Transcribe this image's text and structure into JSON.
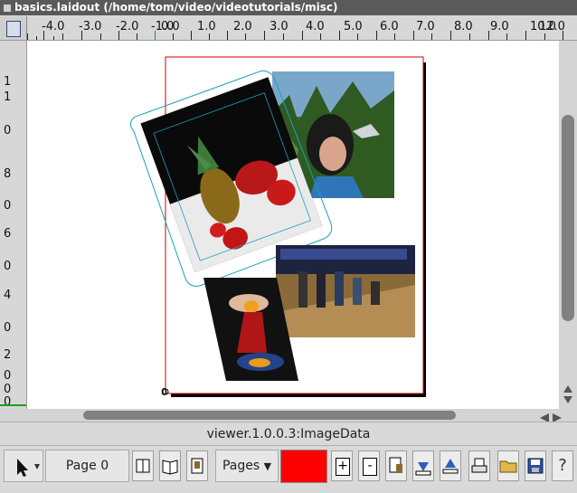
{
  "window": {
    "title": "basics.laidout (/home/tom/video/videotutorials/misc)"
  },
  "ruler": {
    "labels": [
      "-4.0",
      "-3.0",
      "-2.0",
      "-1.0",
      "0.0",
      "1.0",
      "2.0",
      "3.0",
      "4.0",
      "5.0",
      "6.0",
      "7.0",
      "8.0",
      "9.0",
      "10.0",
      "12.0"
    ],
    "vertical_labels": [
      "1",
      "1",
      "0",
      "8",
      "0",
      "6",
      "0",
      "4",
      "0",
      "2",
      "0",
      "0",
      "0"
    ]
  },
  "canvas": {
    "page_origin_label": "0",
    "page_border_color": "#cc0000",
    "frame_color": "#1aa0b8"
  },
  "status": {
    "text": "viewer.1.0.0.3:ImageData"
  },
  "toolbar": {
    "page_label": "Page 0",
    "pages_label": "Pages",
    "pages_dropdown": "▼",
    "color_swatch": "#ff0000",
    "add_label": "+",
    "remove_label": "-",
    "help_label": "?"
  },
  "icons": [
    "arrow-select-icon",
    "book-single-icon",
    "book-open-icon",
    "page-turn-icon",
    "insert-page-icon",
    "import-icon",
    "export-icon",
    "print-icon",
    "open-folder-icon",
    "save-icon",
    "help-icon"
  ]
}
